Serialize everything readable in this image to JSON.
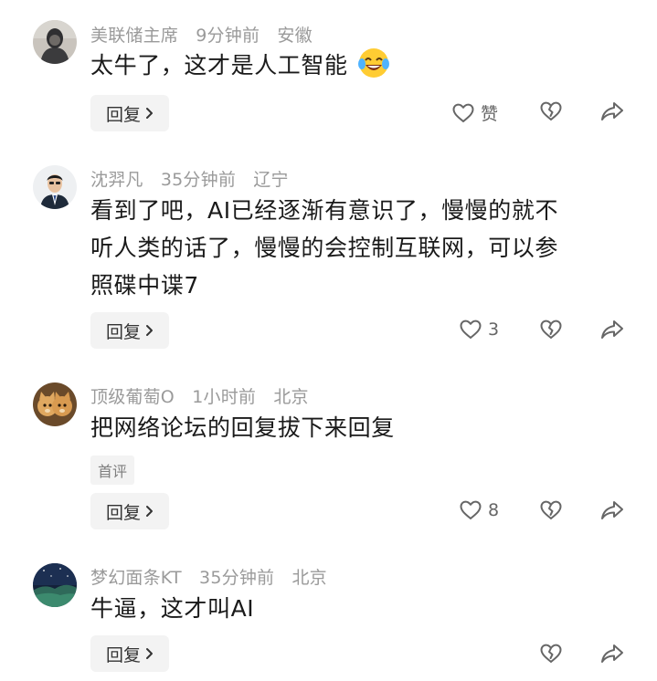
{
  "comments": [
    {
      "user": "美联储主席",
      "time": "9分钟前",
      "region": "安徽",
      "text": "太牛了，这才是人工智能",
      "emoji": "laughing-tears-emoji",
      "reply_label": "回复",
      "like_label": "赞",
      "avatar": "person-in-dark-hoodie-avatar"
    },
    {
      "user": "沈羿凡",
      "time": "35分钟前",
      "region": "辽宁",
      "text_lines": [
        "看到了吧，AI已经逐渐有意识了，慢慢的就不",
        "听人类的话了，慢慢的会控制互联网，可以参",
        "照碟中谍7"
      ],
      "reply_label": "回复",
      "like_count": "3",
      "avatar": "person-in-suit-avatar"
    },
    {
      "user": "顶级葡萄O",
      "time": "1小时前",
      "region": "北京",
      "text": "把网络论坛的回复拔下来回复",
      "tag": "首评",
      "reply_label": "回复",
      "like_count": "8",
      "avatar": "two-cats-avatar"
    },
    {
      "user": "梦幻面条KT",
      "time": "35分钟前",
      "region": "北京",
      "text": "牛逼，这才叫AI",
      "reply_label": "回复",
      "avatar": "night-sky-landscape-avatar"
    }
  ],
  "colors": {
    "meta": "#9a9a9a",
    "text": "#1a1a1a",
    "pill_bg": "#f3f3f3",
    "icon": "#666666"
  }
}
